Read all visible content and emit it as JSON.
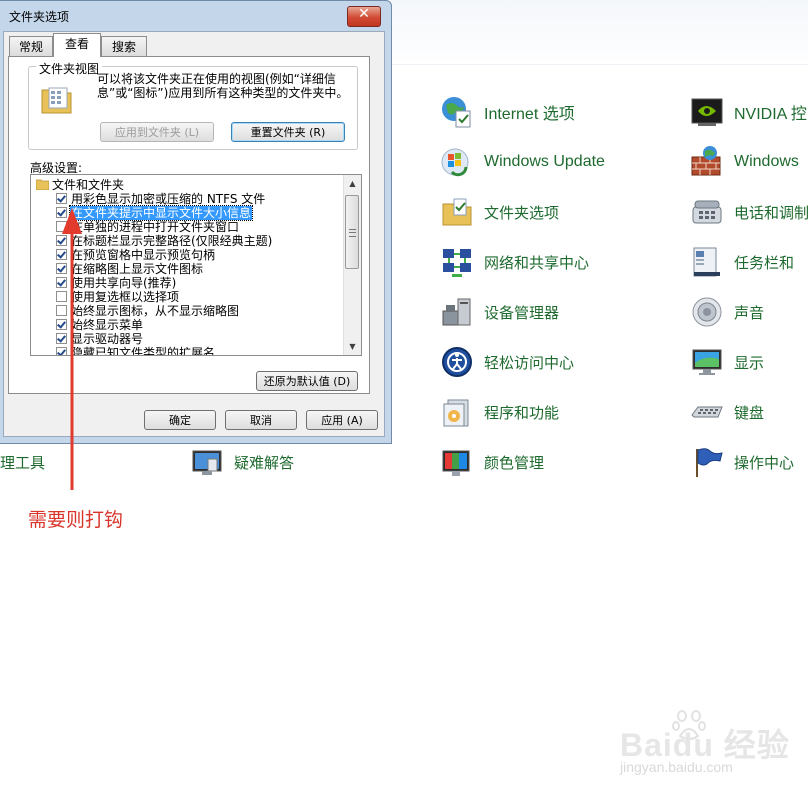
{
  "dialog": {
    "title": "文件夹选项",
    "close_glyph": "✕",
    "tabs": [
      {
        "label": "常规",
        "active": false
      },
      {
        "label": "查看",
        "active": true
      },
      {
        "label": "搜索",
        "active": false
      }
    ],
    "folder_views": {
      "group_title": "文件夹视图",
      "description": "可以将该文件夹正在使用的视图(例如“详细信息”或“图标”)应用到所有这种类型的文件夹中。",
      "apply_button": "应用到文件夹 (L)",
      "reset_button": "重置文件夹 (R)"
    },
    "advanced_label": "高级设置:",
    "settings": [
      {
        "label": "文件和文件夹",
        "type": "folder"
      },
      {
        "label": "用彩色显示加密或压缩的 NTFS 文件",
        "checked": true
      },
      {
        "label": "在文件夹提示中显示文件大小信息",
        "checked": true,
        "selected": true
      },
      {
        "label": "在单独的进程中打开文件夹窗口",
        "checked": false
      },
      {
        "label": "在标题栏显示完整路径(仅限经典主题)",
        "checked": true
      },
      {
        "label": "在预览窗格中显示预览句柄",
        "checked": true
      },
      {
        "label": "在缩略图上显示文件图标",
        "checked": true
      },
      {
        "label": "使用共享向导(推荐)",
        "checked": true
      },
      {
        "label": "使用复选框以选择项",
        "checked": false
      },
      {
        "label": "始终显示图标，从不显示缩略图",
        "checked": false
      },
      {
        "label": "始终显示菜单",
        "checked": true
      },
      {
        "label": "显示驱动器号",
        "checked": true
      },
      {
        "label": "隐藏已知文件类型的扩展名",
        "checked": true
      }
    ],
    "restore_button": "还原为默认值 (D)",
    "ok_button": "确定",
    "cancel_button": "取消",
    "apply_button": "应用 (A)"
  },
  "control_panel": {
    "items": [
      {
        "label": "Internet 选项",
        "icon": "internet-options-icon"
      },
      {
        "label": "Windows Update",
        "icon": "windows-update-icon"
      },
      {
        "label": "文件夹选项",
        "icon": "folder-options-icon"
      },
      {
        "label": "网络和共享中心",
        "icon": "network-center-icon"
      },
      {
        "label": "设备管理器",
        "icon": "device-manager-icon"
      },
      {
        "label": "轻松访问中心",
        "icon": "ease-of-access-icon"
      },
      {
        "label": "程序和功能",
        "icon": "programs-features-icon"
      },
      {
        "label": "颜色管理",
        "icon": "color-management-icon"
      },
      {
        "label": "NVIDIA 控",
        "icon": "nvidia-icon"
      },
      {
        "label": "Windows",
        "icon": "windows-firewall-icon"
      },
      {
        "label": "电话和调制",
        "icon": "phone-modem-icon"
      },
      {
        "label": "任务栏和",
        "icon": "taskbar-icon"
      },
      {
        "label": "声音",
        "icon": "sound-icon"
      },
      {
        "label": "显示",
        "icon": "display-icon"
      },
      {
        "label": "键盘",
        "icon": "keyboard-icon"
      },
      {
        "label": "操作中心",
        "icon": "action-center-icon"
      },
      {
        "label": "疑难解答",
        "icon": "troubleshooting-icon"
      },
      {
        "label": "理工具",
        "icon": "admin-tools-icon"
      }
    ],
    "link_color": "#1e6a2e"
  },
  "annotation": {
    "text": "需要则打钩",
    "color": "#d9352b"
  },
  "watermark": {
    "main": "Baidu 经验",
    "sub": "jingyan.baidu.com"
  }
}
